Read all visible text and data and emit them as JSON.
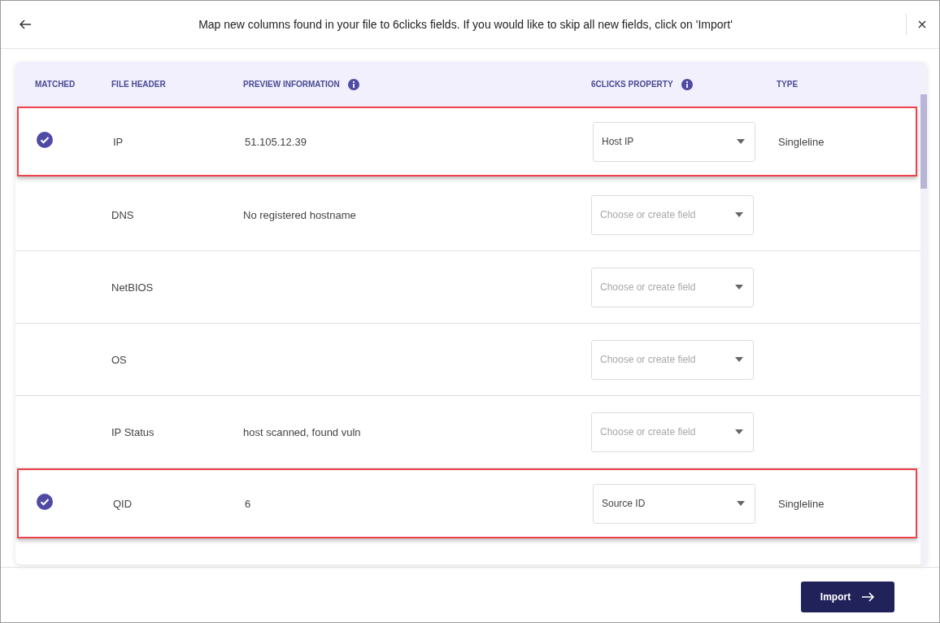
{
  "dialog": {
    "title": "Map new columns found in your file to 6clicks fields. If you would like to skip all new fields, click on 'Import'"
  },
  "table": {
    "columns": [
      {
        "label": "MATCHED",
        "info": false
      },
      {
        "label": "FILE HEADER",
        "info": false
      },
      {
        "label": "PREVIEW INFORMATION",
        "info": true
      },
      {
        "label": "6CLICKS PROPERTY",
        "info": true
      },
      {
        "label": "TYPE",
        "info": false
      }
    ],
    "rows": [
      {
        "matched": true,
        "highlighted": true,
        "file_header": "IP",
        "preview": "51.105.12.39",
        "property": {
          "value": "Host IP"
        },
        "type": "Singleline"
      },
      {
        "matched": false,
        "highlighted": false,
        "file_header": "DNS",
        "preview": "No registered hostname",
        "property": {
          "placeholder": "Choose or create field"
        }
      },
      {
        "matched": false,
        "highlighted": false,
        "file_header": "NetBIOS",
        "property": {
          "placeholder": "Choose or create field"
        }
      },
      {
        "matched": false,
        "highlighted": false,
        "file_header": "OS",
        "property": {
          "placeholder": "Choose or create field"
        }
      },
      {
        "matched": false,
        "highlighted": false,
        "file_header": "IP Status",
        "preview": "host scanned, found vuln",
        "property": {
          "placeholder": "Choose or create field"
        }
      },
      {
        "matched": true,
        "highlighted": true,
        "file_header": "QID",
        "preview": "6",
        "property": {
          "value": "Source ID"
        },
        "type": "Singleline"
      }
    ]
  },
  "footer": {
    "button": "Import"
  }
}
